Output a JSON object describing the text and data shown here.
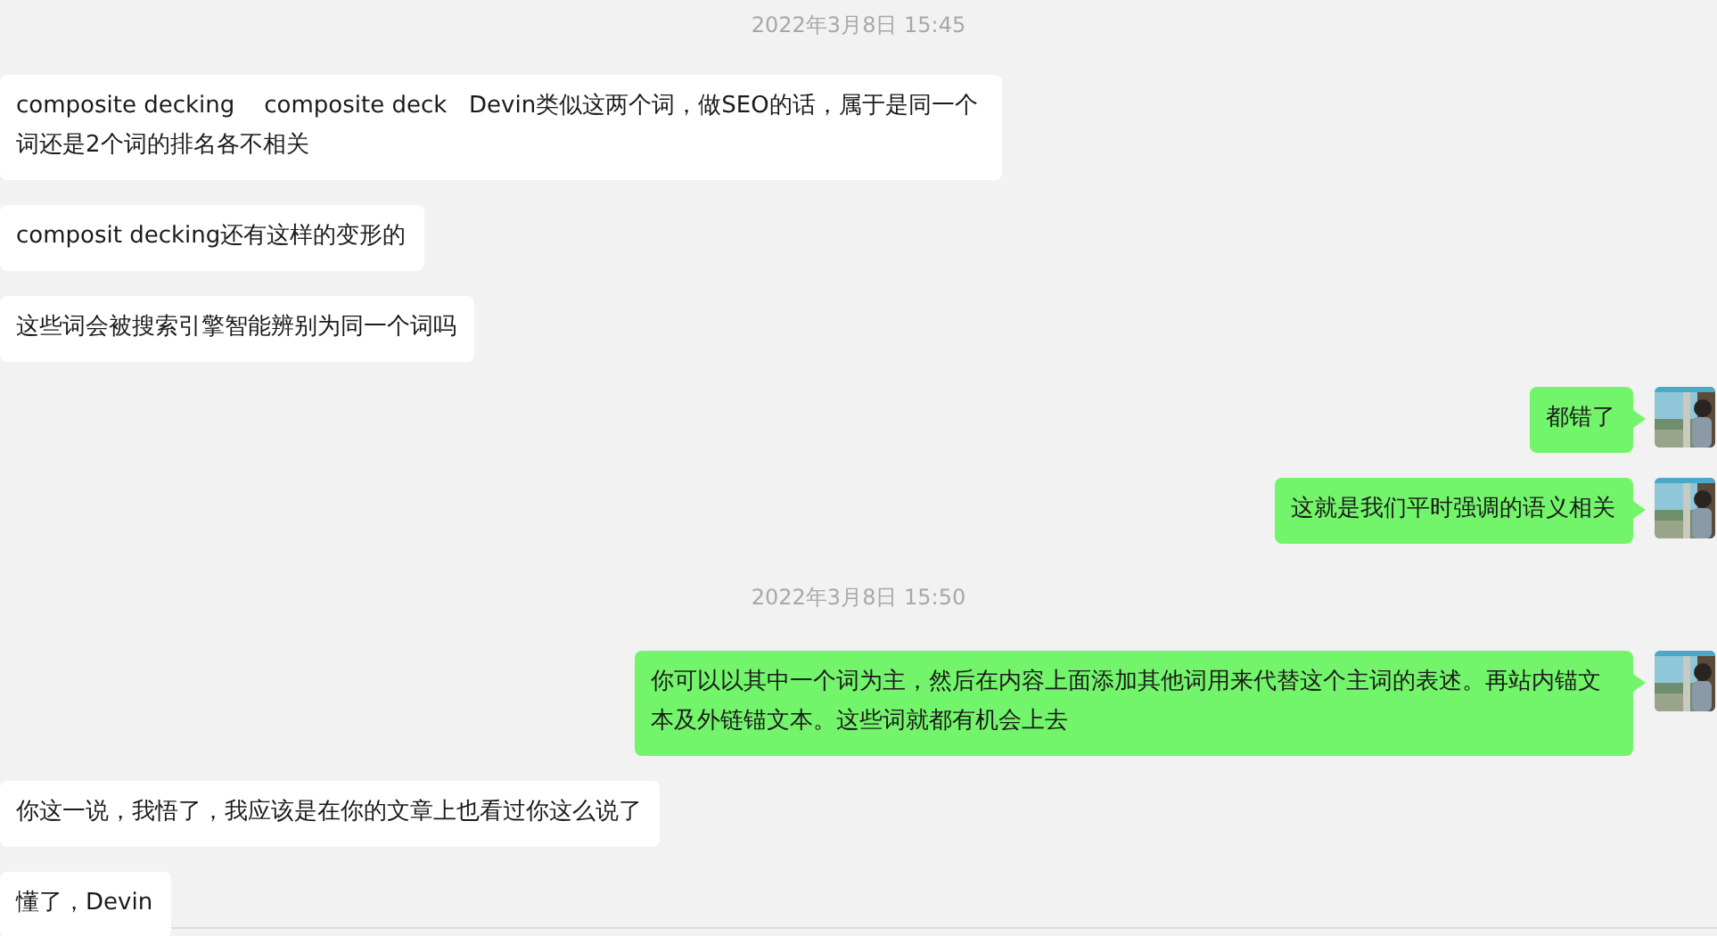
{
  "messages": [
    {
      "kind": "time",
      "text": "2022年3月8日 15:45"
    },
    {
      "kind": "received",
      "text": "composite decking    composite deck   Devin类似这两个词，做SEO的话，属于是同一个词还是2个词的排名各不相关"
    },
    {
      "kind": "received",
      "text": "composit decking还有这样的变形的"
    },
    {
      "kind": "received",
      "text": "这些词会被搜索引擎智能辨别为同一个词吗"
    },
    {
      "kind": "sent",
      "text": "都错了"
    },
    {
      "kind": "sent",
      "text": "这就是我们平时强调的语义相关"
    },
    {
      "kind": "time",
      "text": "2022年3月8日 15:50"
    },
    {
      "kind": "sent",
      "text": "你可以以其中一个词为主，然后在内容上面添加其他词用来代替这个主词的表述。再站内锚文本及外链锚文本。这些词就都有机会上去"
    },
    {
      "kind": "received",
      "text": "你这一说，我悟了，我应该是在你的文章上也看过你这么说了"
    },
    {
      "kind": "received",
      "text": "懂了，Devin"
    }
  ]
}
